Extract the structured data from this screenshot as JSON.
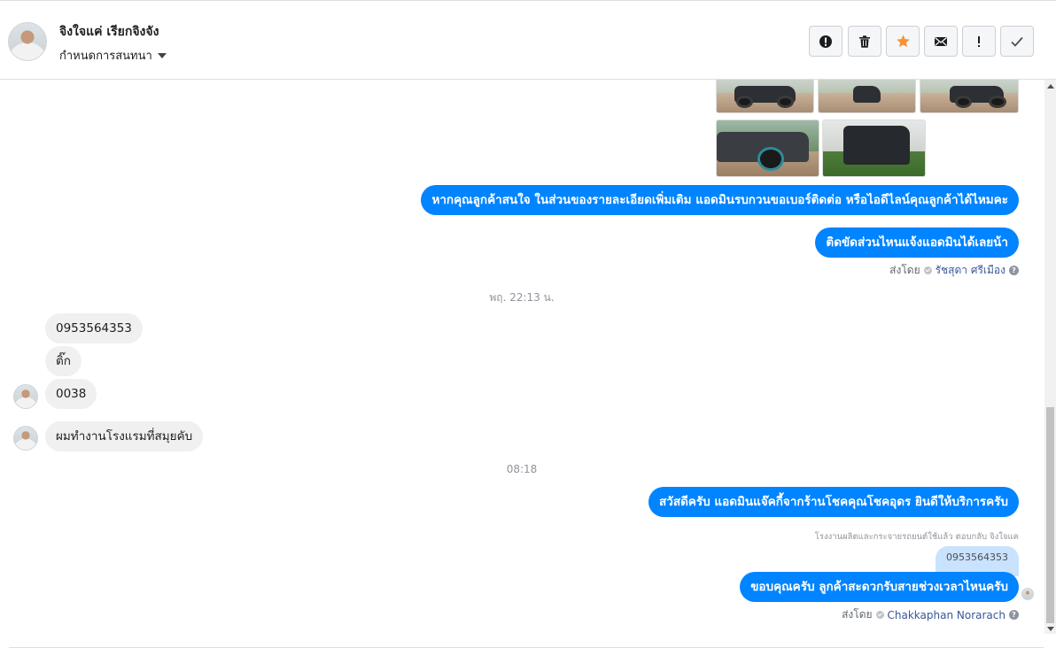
{
  "header": {
    "contact_name": "จิงใจแค่ เรียกจิงจัง",
    "conversation_settings": "กำหนดการสนทนา"
  },
  "toolbar": {
    "buttons": [
      "mark-spam",
      "delete",
      "star",
      "mark-unread",
      "follow-up",
      "mark-done"
    ]
  },
  "thread": {
    "msg_interest": "หากคุณลูกค้าสนใจ ในส่วนของรายละเอียดเพิ่มเติม แอดมินรบกวนขอเบอร์ติดต่อ หรือไอดีไลน์คุณลูกค้าได้ไหมคะ",
    "msg_ask_part": "ติดขัดส่วนไหนแจ้งแอดมินได้เลยน้า",
    "sent_by_1_label": "ส่งโดย",
    "sent_by_1_name": "รัชสุดา ศรีเมือง",
    "time_1": "พฤ. 22:13 น.",
    "in_phone": "0953564353",
    "in_name": "ติ๊ก",
    "in_ext": "0038",
    "in_work": "ผมทำงานโรงแรมที่สมุยคับ",
    "time_2": "08:18",
    "msg_greeting": "สวัสดีครับ แอดมินแจ๊คกี้จากร้านโชคคุณโชคอุดร ยินดีให้บริการครับ",
    "reply_note": "โรงงานผลิตและกระจายรถยนต์ใช้แล้ว ตอบกลับ จิงใจแค",
    "quoted_text": "0953564353",
    "msg_thanks": "ขอบคุณครับ ลูกค้าสะดวกรับสายช่วงเวลาไหนครับ",
    "sent_by_2_label": "ส่งโดย",
    "sent_by_2_name": "Chakkaphan Norarach"
  }
}
